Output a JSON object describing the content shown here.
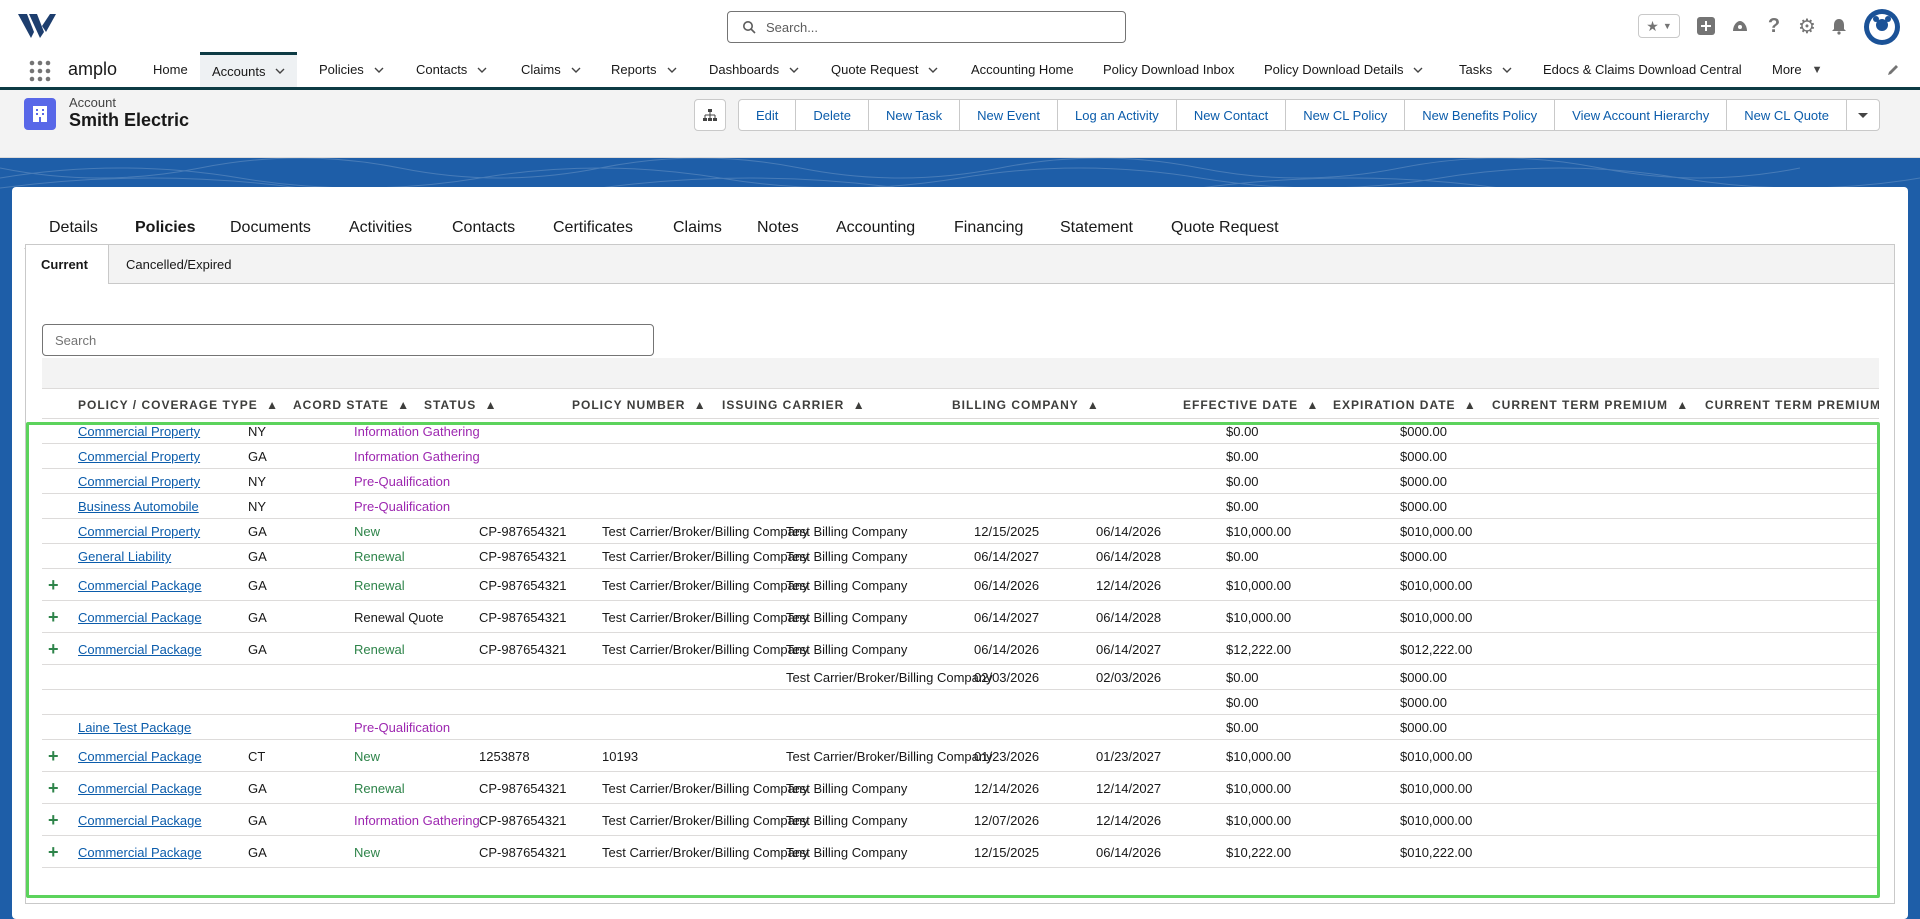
{
  "global_search": {
    "placeholder": "Search..."
  },
  "app": {
    "name": "amplo"
  },
  "nav": {
    "items": [
      {
        "label": "Home",
        "has_menu": false
      },
      {
        "label": "Accounts",
        "has_menu": true,
        "active": true
      },
      {
        "label": "Policies",
        "has_menu": true
      },
      {
        "label": "Contacts",
        "has_menu": true
      },
      {
        "label": "Claims",
        "has_menu": true
      },
      {
        "label": "Reports",
        "has_menu": true
      },
      {
        "label": "Dashboards",
        "has_menu": true
      },
      {
        "label": "Quote Request",
        "has_menu": true
      },
      {
        "label": "Accounting Home",
        "has_menu": false
      },
      {
        "label": "Policy Download Inbox",
        "has_menu": false
      },
      {
        "label": "Policy Download Details",
        "has_menu": true
      },
      {
        "label": "Tasks",
        "has_menu": true
      },
      {
        "label": "Edocs & Claims Download Central",
        "has_menu": false
      },
      {
        "label": "More",
        "has_menu": true
      }
    ]
  },
  "record": {
    "type": "Account",
    "title": "Smith Electric",
    "actions": [
      "Edit",
      "Delete",
      "New Task",
      "New Event",
      "Log an Activity",
      "New Contact",
      "New CL Policy",
      "New Benefits Policy",
      "View Account Hierarchy",
      "New CL Quote"
    ]
  },
  "tabs": [
    "Details",
    "Policies",
    "Documents",
    "Activities",
    "Contacts",
    "Certificates",
    "Claims",
    "Notes",
    "Accounting",
    "Financing",
    "Statement",
    "Quote Request"
  ],
  "active_tab": "Policies",
  "subtabs": [
    "Current",
    "Cancelled/Expired"
  ],
  "active_subtab": "Current",
  "table_search": {
    "placeholder": "Search"
  },
  "columns": [
    "POLICY / COVERAGE TYPE",
    "ACORD STATE",
    "STATUS",
    "POLICY NUMBER",
    "ISSUING CARRIER",
    "BILLING COMPANY",
    "EFFECTIVE DATE",
    "EXPIRATION DATE",
    "CURRENT TERM PREMIUM",
    "CURRENT TERM PREMIUM"
  ],
  "sort_glyph": "▲",
  "status_colors": {
    "Information Gathering": "#9d27b0",
    "Pre-Qualification": "#9d27b0",
    "New": "#2e844a",
    "Renewal": "#2e844a",
    "Renewal Quote": "#181818"
  },
  "rows": [
    {
      "expand": false,
      "type": "Commercial Property",
      "state": "NY",
      "status": "Information Gathering",
      "policy": "",
      "carrier": "",
      "billing": "",
      "eff": "",
      "exp": "",
      "prem": "$0.00",
      "prem2": "$000.00"
    },
    {
      "expand": false,
      "type": "Commercial Property",
      "state": "GA",
      "status": "Information Gathering",
      "policy": "",
      "carrier": "",
      "billing": "",
      "eff": "",
      "exp": "",
      "prem": "$0.00",
      "prem2": "$000.00"
    },
    {
      "expand": false,
      "type": "Commercial Property",
      "state": "NY",
      "status": "Pre-Qualification",
      "policy": "",
      "carrier": "",
      "billing": "",
      "eff": "",
      "exp": "",
      "prem": "$0.00",
      "prem2": "$000.00"
    },
    {
      "expand": false,
      "type": "Business Automobile",
      "state": "NY",
      "status": "Pre-Qualification",
      "policy": "",
      "carrier": "",
      "billing": "",
      "eff": "",
      "exp": "",
      "prem": "$0.00",
      "prem2": "$000.00"
    },
    {
      "expand": false,
      "type": "Commercial Property",
      "state": "GA",
      "status": "New",
      "policy": "CP-987654321",
      "carrier": "Test Carrier/Broker/Billing Company",
      "billing": "Test Billing Company",
      "eff": "12/15/2025",
      "exp": "06/14/2026",
      "prem": "$10,000.00",
      "prem2": "$010,000.00"
    },
    {
      "expand": false,
      "type": "General Liability",
      "state": "GA",
      "status": "Renewal",
      "policy": "CP-987654321",
      "carrier": "Test Carrier/Broker/Billing Company",
      "billing": "Test Billing Company",
      "eff": "06/14/2027",
      "exp": "06/14/2028",
      "prem": "$0.00",
      "prem2": "$000.00"
    },
    {
      "expand": true,
      "type": "Commercial Package",
      "state": "GA",
      "status": "Renewal",
      "policy": "CP-987654321",
      "carrier": "Test Carrier/Broker/Billing Company",
      "billing": "Test Billing Company",
      "eff": "06/14/2026",
      "exp": "12/14/2026",
      "prem": "$10,000.00",
      "prem2": "$010,000.00"
    },
    {
      "expand": true,
      "type": "Commercial Package",
      "state": "GA",
      "status": "Renewal Quote",
      "policy": "CP-987654321",
      "carrier": "Test Carrier/Broker/Billing Company",
      "billing": "Test Billing Company",
      "eff": "06/14/2027",
      "exp": "06/14/2028",
      "prem": "$10,000.00",
      "prem2": "$010,000.00"
    },
    {
      "expand": true,
      "type": "Commercial Package",
      "state": "GA",
      "status": "Renewal",
      "policy": "CP-987654321",
      "carrier": "Test Carrier/Broker/Billing Company",
      "billing": "Test Billing Company",
      "eff": "06/14/2026",
      "exp": "06/14/2027",
      "prem": "$12,222.00",
      "prem2": "$012,222.00"
    },
    {
      "expand": false,
      "type": "",
      "state": "",
      "status": "",
      "policy": "",
      "carrier": "",
      "billing": "Test Carrier/Broker/Billing Company",
      "eff": "02/03/2026",
      "exp": "02/03/2026",
      "prem": "$0.00",
      "prem2": "$000.00"
    },
    {
      "expand": false,
      "type": "",
      "state": "",
      "status": "",
      "policy": "",
      "carrier": "",
      "billing": "",
      "eff": "",
      "exp": "",
      "prem": "$0.00",
      "prem2": "$000.00"
    },
    {
      "expand": false,
      "type": "Laine Test Package",
      "state": "",
      "status": "Pre-Qualification",
      "policy": "",
      "carrier": "",
      "billing": "",
      "eff": "",
      "exp": "",
      "prem": "$0.00",
      "prem2": "$000.00"
    },
    {
      "expand": true,
      "type": "Commercial Package",
      "state": "CT",
      "status": "New",
      "policy": "1253878",
      "carrier": "10193",
      "billing": "Test Carrier/Broker/Billing Company",
      "eff": "01/23/2026",
      "exp": "01/23/2027",
      "prem": "$10,000.00",
      "prem2": "$010,000.00"
    },
    {
      "expand": true,
      "type": "Commercial Package",
      "state": "GA",
      "status": "Renewal",
      "policy": "CP-987654321",
      "carrier": "Test Carrier/Broker/Billing Company",
      "billing": "Test Billing Company",
      "eff": "12/14/2026",
      "exp": "12/14/2027",
      "prem": "$10,000.00",
      "prem2": "$010,000.00"
    },
    {
      "expand": true,
      "type": "Commercial Package",
      "state": "GA",
      "status": "Information Gathering",
      "policy": "CP-987654321",
      "carrier": "Test Carrier/Broker/Billing Company",
      "billing": "Test Billing Company",
      "eff": "12/07/2026",
      "exp": "12/14/2026",
      "prem": "$10,000.00",
      "prem2": "$010,000.00"
    },
    {
      "expand": true,
      "type": "Commercial Package",
      "state": "GA",
      "status": "New",
      "policy": "CP-987654321",
      "carrier": "Test Carrier/Broker/Billing Company",
      "billing": "Test Billing Company",
      "eff": "12/15/2025",
      "exp": "06/14/2026",
      "prem": "$10,222.00",
      "prem2": "$010,222.00"
    }
  ],
  "icons": {
    "logo": "amplo-logo-icon",
    "search": "search-icon",
    "favorites": "star-icon",
    "add": "plus-icon",
    "trailhead": "trailhead-icon",
    "help": "help-icon",
    "setup": "gear-icon",
    "notifications": "bell-icon",
    "avatar": "user-avatar-icon",
    "launcher": "app-launcher-icon",
    "edit_nav": "pencil-icon",
    "record": "account-icon",
    "hierarchy": "hierarchy-icon",
    "expand": "plus-icon"
  }
}
